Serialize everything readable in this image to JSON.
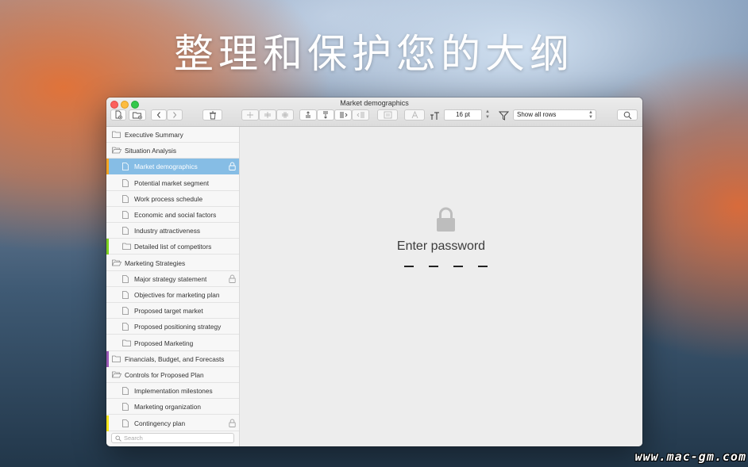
{
  "headline": "整理和保护您的大纲",
  "watermark": "www.mac-gm.com",
  "window": {
    "title": "Market demographics"
  },
  "toolbar": {
    "icons": [
      "new-document-icon",
      "new-folder-icon",
      "back-icon",
      "forward-icon",
      "trash-icon",
      "indent-icons",
      "align-icons",
      "note-icon",
      "text-color-icon",
      "text-size-icon",
      "filter-icon",
      "search-icon"
    ],
    "font_size": "16 pt",
    "filter_selected": "Show all rows"
  },
  "sidebar": {
    "items": [
      {
        "label": "Executive Summary",
        "type": "folder",
        "level": 0
      },
      {
        "label": "Situation Analysis",
        "type": "folder-open",
        "level": 0
      },
      {
        "label": "Market demographics",
        "type": "doc",
        "level": 1,
        "selected": true,
        "locked": true,
        "marker": "#f5a623"
      },
      {
        "label": "Potential market segment",
        "type": "doc",
        "level": 1
      },
      {
        "label": "Work process schedule",
        "type": "doc",
        "level": 1
      },
      {
        "label": "Economic and social factors",
        "type": "doc",
        "level": 1
      },
      {
        "label": "Industry attractiveness",
        "type": "doc",
        "level": 1
      },
      {
        "label": "Detailed list of competitors",
        "type": "folder",
        "level": 1,
        "marker": "#7ed321"
      },
      {
        "label": "Marketing Strategies",
        "type": "folder-open",
        "level": 0
      },
      {
        "label": "Major strategy statement",
        "type": "doc",
        "level": 1,
        "locked": true
      },
      {
        "label": "Objectives for marketing plan",
        "type": "doc",
        "level": 1
      },
      {
        "label": "Proposed target market",
        "type": "doc",
        "level": 1
      },
      {
        "label": "Proposed positioning strategy",
        "type": "doc",
        "level": 1
      },
      {
        "label": "Proposed Marketing",
        "type": "folder",
        "level": 1
      },
      {
        "label": "Financials, Budget, and Forecasts",
        "type": "folder",
        "level": 0,
        "marker": "#9b59b6"
      },
      {
        "label": "Controls for Proposed Plan",
        "type": "folder-open",
        "level": 0
      },
      {
        "label": "Implementation milestones",
        "type": "doc",
        "level": 1
      },
      {
        "label": "Marketing organization",
        "type": "doc",
        "level": 1
      },
      {
        "label": "Contingency plan",
        "type": "doc",
        "level": 1,
        "locked": true,
        "marker": "#f8e71c"
      }
    ],
    "search_placeholder": "Search"
  },
  "main": {
    "prompt": "Enter password",
    "password_slots": 4
  }
}
